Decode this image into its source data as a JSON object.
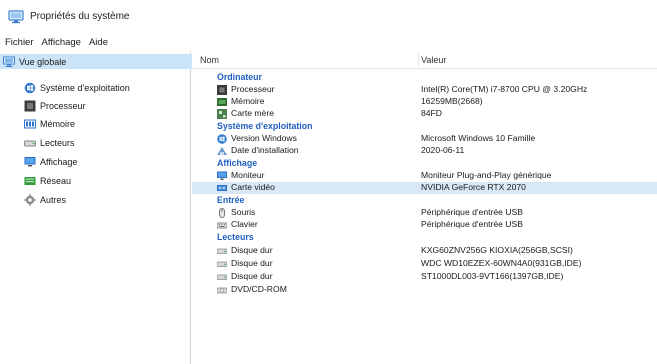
{
  "window": {
    "title": "Propriétés du système"
  },
  "menubar": {
    "items": [
      "Fichier",
      "Affichage",
      "Aide"
    ]
  },
  "sidebar": {
    "root": {
      "label": "Vue globale",
      "icon": "computer-icon"
    },
    "items": [
      {
        "label": "Système d'exploitation",
        "icon": "windows-os-icon"
      },
      {
        "label": "Processeur",
        "icon": "processor-icon"
      },
      {
        "label": "Mémoire",
        "icon": "memory-icon"
      },
      {
        "label": "Lecteurs",
        "icon": "drive-icon"
      },
      {
        "label": "Affichage",
        "icon": "display-icon"
      },
      {
        "label": "Réseau",
        "icon": "network-icon"
      },
      {
        "label": "Autres",
        "icon": "gear-icon"
      }
    ]
  },
  "table": {
    "headers": {
      "name": "Nom",
      "value": "Valeur"
    },
    "rows": [
      {
        "type": "group",
        "label": "Ordinateur"
      },
      {
        "type": "item",
        "icon": "processor-icon",
        "name": "Processeur",
        "value": "Intel(R) Core(TM) i7-8700 CPU @ 3.20GHz"
      },
      {
        "type": "item",
        "icon": "memory-icon",
        "name": "Mémoire",
        "value": "16259MB(2668)"
      },
      {
        "type": "item",
        "icon": "motherboard-icon",
        "name": "Carte mère",
        "value": "84FD"
      },
      {
        "type": "group",
        "label": "Système d'exploitation"
      },
      {
        "type": "item",
        "icon": "windows-os-icon",
        "name": "Version Windows",
        "value": "Microsoft Windows 10 Famille"
      },
      {
        "type": "item",
        "icon": "install-date-icon",
        "name": "Date d'installation",
        "value": "2020-06-11"
      },
      {
        "type": "group",
        "label": "Affichage"
      },
      {
        "type": "item",
        "icon": "monitor-icon",
        "name": "Moniteur",
        "value": "Moniteur Plug-and-Play générique"
      },
      {
        "type": "item",
        "icon": "video-card-icon",
        "name": "Carte vidéo",
        "value": "NVIDIA GeForce RTX 2070",
        "selected": true
      },
      {
        "type": "group",
        "label": "Entrée"
      },
      {
        "type": "item",
        "icon": "mouse-icon",
        "name": "Souris",
        "value": "Périphérique d'entrée USB"
      },
      {
        "type": "item",
        "icon": "keyboard-icon",
        "name": "Clavier",
        "value": "Périphérique d'entrée USB"
      },
      {
        "type": "group",
        "label": "Lecteurs"
      },
      {
        "type": "item",
        "icon": "drive-icon",
        "name": "Disque dur",
        "value": "KXG60ZNV256G KIOXIA(256GB,SCSI)"
      },
      {
        "type": "item",
        "icon": "drive-icon",
        "name": "Disque dur",
        "value": "WDC WD10EZEX-60WN4A0(931GB,IDE)"
      },
      {
        "type": "item",
        "icon": "drive-icon",
        "name": "Disque dur",
        "value": "ST1000DL003-9VT166(1397GB,IDE)"
      },
      {
        "type": "item",
        "icon": "dvd-drive-icon",
        "name": "DVD/CD-ROM",
        "value": ""
      }
    ]
  },
  "colors": {
    "group_label": "#1f5fbf",
    "selection": "#cce4f7",
    "row_selected": "#d9e8f6",
    "divider": "#d4d4d4"
  }
}
